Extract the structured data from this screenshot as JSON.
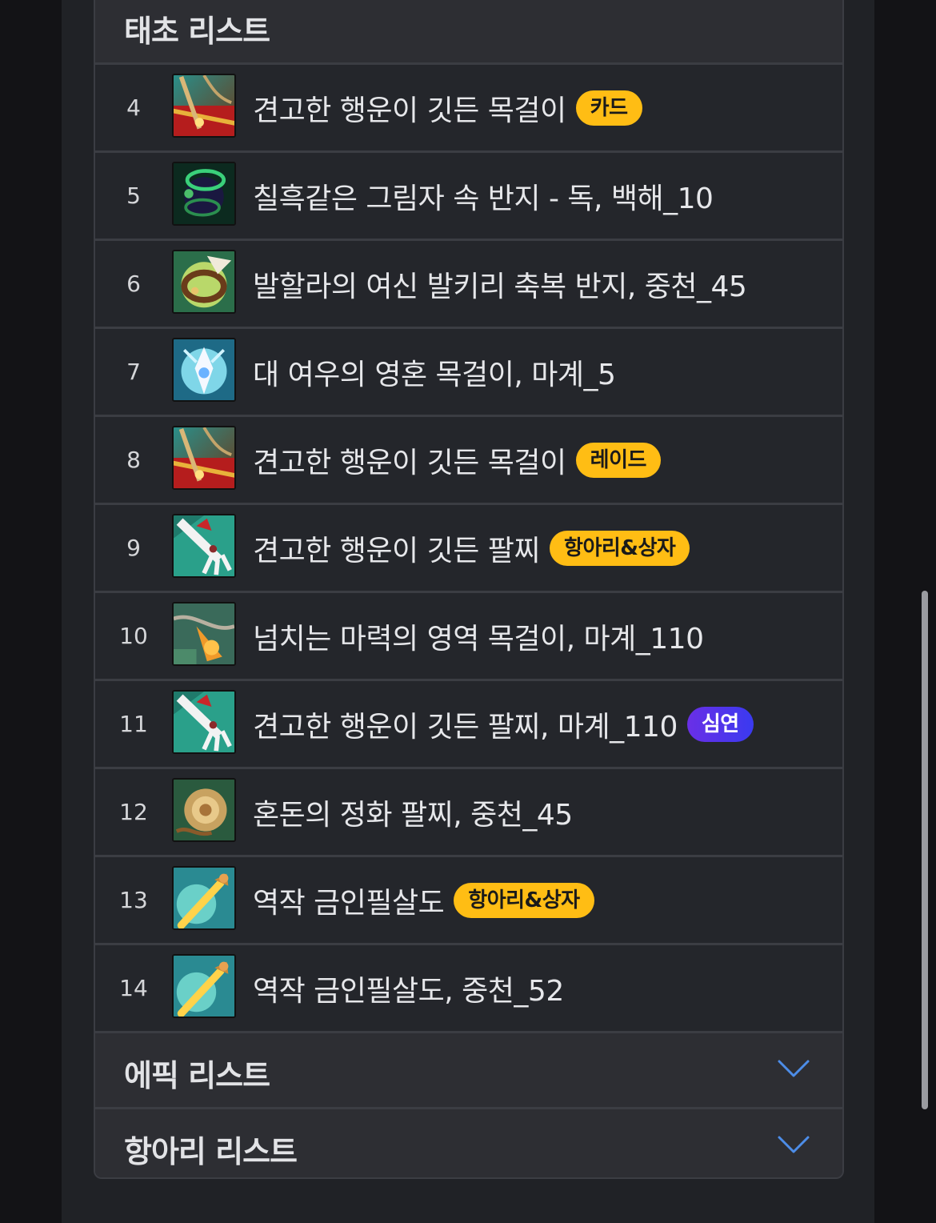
{
  "taecho_list": {
    "title": "태초 리스트",
    "items": [
      {
        "rank": "4",
        "name": "견고한 행운이 깃든 목걸이",
        "badge": "카드",
        "badge_color": "#ffbd14",
        "icon": "necklace-red-icon"
      },
      {
        "rank": "5",
        "name": "칠흑같은 그림자 속 반지 - 독, 백해_10",
        "badge": null,
        "icon": "shadow-ring-icon"
      },
      {
        "rank": "6",
        "name": "발할라의 여신 발키리 축복 반지, 중천_45",
        "badge": null,
        "icon": "valkyrie-ring-icon"
      },
      {
        "rank": "7",
        "name": "대 여우의 영혼 목걸이, 마계_5",
        "badge": null,
        "icon": "fox-necklace-icon"
      },
      {
        "rank": "8",
        "name": "견고한 행운이 깃든 목걸이",
        "badge": "레이드",
        "badge_color": "#ffbd14",
        "icon": "necklace-red-icon"
      },
      {
        "rank": "9",
        "name": "견고한 행운이 깃든 팔찌",
        "badge": "항아리&상자",
        "badge_color": "#ffbd14",
        "icon": "bracelet-icon"
      },
      {
        "rank": "10",
        "name": "넘치는 마력의 영역 목걸이, 마계_110",
        "badge": null,
        "icon": "mana-necklace-icon"
      },
      {
        "rank": "11",
        "name": "견고한 행운이 깃든 팔찌, 마계_110",
        "badge": "심연",
        "badge_color": "#5a34ea",
        "icon": "bracelet-icon"
      },
      {
        "rank": "12",
        "name": "혼돈의 정화 팔찌, 중천_45",
        "badge": null,
        "icon": "chaos-bracelet-icon"
      },
      {
        "rank": "13",
        "name": "역작 금인필살도",
        "badge": "항아리&상자",
        "badge_color": "#ffbd14",
        "icon": "golden-sword-icon"
      },
      {
        "rank": "14",
        "name": "역작 금인필살도, 중천_52",
        "badge": null,
        "icon": "golden-sword-icon"
      }
    ]
  },
  "epic_list": {
    "title": "에픽 리스트",
    "icon": "chevron-down-icon",
    "accent": "#4d8de8"
  },
  "jar_list": {
    "title": "항아리 리스트",
    "icon": "chevron-down-icon",
    "accent": "#4d8de8"
  }
}
